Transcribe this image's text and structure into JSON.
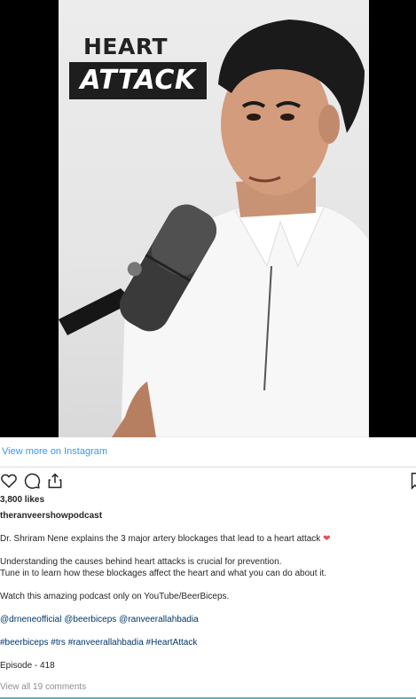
{
  "media": {
    "overlay_title_top": "HEART",
    "overlay_title_bottom": "ATTACK"
  },
  "view_more": "View more on Instagram",
  "actions": {
    "like_icon": "heart-outline-icon",
    "comment_icon": "comment-bubble-icon",
    "share_icon": "share-upload-icon",
    "save_icon": "bookmark-icon"
  },
  "likes": "3,800 likes",
  "username": "theranveershowpodcast",
  "caption": {
    "line1": "Dr. Shriram Nene explains the 3 major artery blockages that lead to a heart attack",
    "line1_emoji": "❤",
    "line2": "Understanding the causes behind heart attacks is crucial for prevention.",
    "line3": "Tune in to learn how these blockages affect the heart and what you can do about it.",
    "line4": "Watch this amazing podcast only on YouTube/BeerBiceps.",
    "mentions": "@drneneofficial @beerbiceps @ranveerallahbadia",
    "hashtags": "#beerbiceps #trs #ranveerallahbadia #HeartAttack",
    "episode": "Episode - 418"
  },
  "comments_link": "View all 19 comments",
  "colors": {
    "link_blue": "#3897f0",
    "tag_blue": "#00376b",
    "heart_red": "#ed4956"
  }
}
